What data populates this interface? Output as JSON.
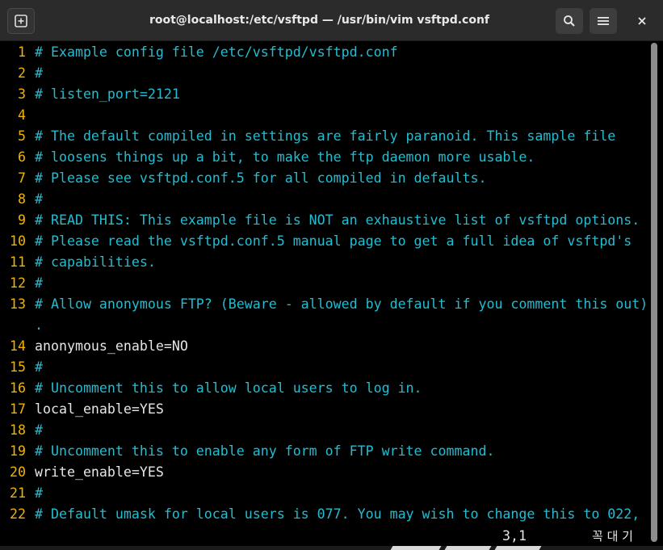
{
  "window": {
    "title": "root@localhost:/etc/vsftpd — /usr/bin/vim vsftpd.conf"
  },
  "icons": {
    "new_tab": "new-tab-icon",
    "search": "search-icon",
    "menu": "hamburger-menu-icon",
    "close": "close-icon"
  },
  "colors": {
    "line_number": "#f0b400",
    "comment": "#24bcd0",
    "code": "#e6e6e6",
    "background": "#000000",
    "titlebar": "#2b2b2b"
  },
  "editor": {
    "lines": [
      {
        "num": "1",
        "text": "# Example config file /etc/vsftpd/vsftpd.conf",
        "kind": "comment"
      },
      {
        "num": "2",
        "text": "#",
        "kind": "comment"
      },
      {
        "num": "3",
        "text": "# listen_port=2121",
        "kind": "comment"
      },
      {
        "num": "4",
        "text": "",
        "kind": "comment"
      },
      {
        "num": "5",
        "text": "# The default compiled in settings are fairly paranoid. This sample file",
        "kind": "comment"
      },
      {
        "num": "6",
        "text": "# loosens things up a bit, to make the ftp daemon more usable.",
        "kind": "comment"
      },
      {
        "num": "7",
        "text": "# Please see vsftpd.conf.5 for all compiled in defaults.",
        "kind": "comment"
      },
      {
        "num": "8",
        "text": "#",
        "kind": "comment"
      },
      {
        "num": "9",
        "text": "# READ THIS: This example file is NOT an exhaustive list of vsftpd options.",
        "kind": "comment"
      },
      {
        "num": "10",
        "text": "# Please read the vsftpd.conf.5 manual page to get a full idea of vsftpd's",
        "kind": "comment"
      },
      {
        "num": "11",
        "text": "# capabilities.",
        "kind": "comment"
      },
      {
        "num": "12",
        "text": "#",
        "kind": "comment"
      },
      {
        "num": "13",
        "text": "# Allow anonymous FTP? (Beware - allowed by default if you comment this out)",
        "kind": "comment"
      },
      {
        "num": "",
        "text": ".",
        "kind": "comment"
      },
      {
        "num": "14",
        "text": "anonymous_enable=NO",
        "kind": "code"
      },
      {
        "num": "15",
        "text": "#",
        "kind": "comment"
      },
      {
        "num": "16",
        "text": "# Uncomment this to allow local users to log in.",
        "kind": "comment"
      },
      {
        "num": "17",
        "text": "local_enable=YES",
        "kind": "code"
      },
      {
        "num": "18",
        "text": "#",
        "kind": "comment"
      },
      {
        "num": "19",
        "text": "# Uncomment this to enable any form of FTP write command.",
        "kind": "comment"
      },
      {
        "num": "20",
        "text": "write_enable=YES",
        "kind": "code"
      },
      {
        "num": "21",
        "text": "#",
        "kind": "comment"
      },
      {
        "num": "22",
        "text": "# Default umask for local users is 077. You may wish to change this to 022,",
        "kind": "comment"
      }
    ]
  },
  "status": {
    "cursor_position": "3,1",
    "input_method": "꼭 대 기"
  }
}
